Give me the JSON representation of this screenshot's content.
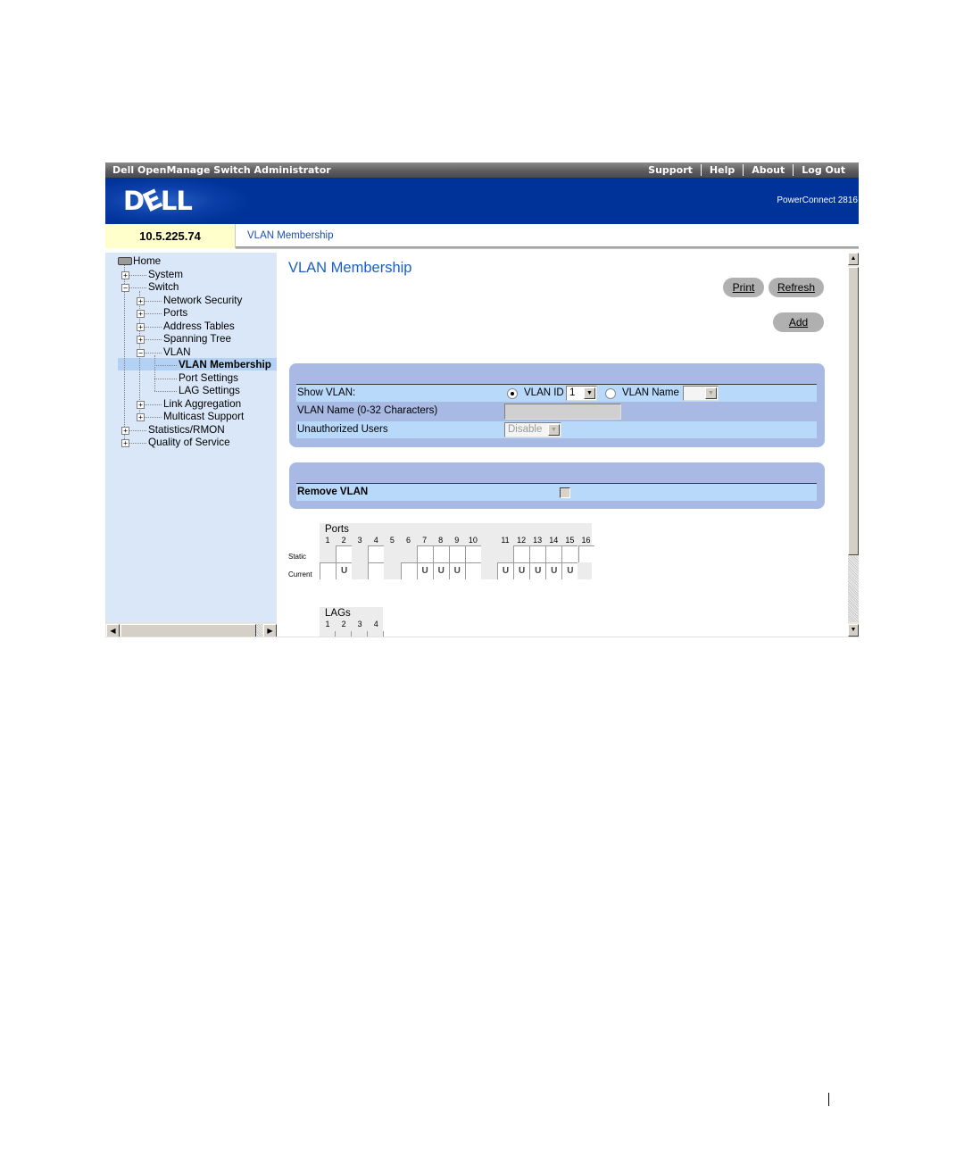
{
  "window": {
    "app_title": "Dell OpenManage Switch Administrator",
    "top_links": [
      "Support",
      "Help",
      "About",
      "Log Out"
    ]
  },
  "banner": {
    "logo": "DELL",
    "model": "PowerConnect 2816"
  },
  "ip_bar": {
    "ip_address": "10.5.225.74",
    "breadcrumb": "VLAN Membership"
  },
  "sidebar": {
    "tree": [
      {
        "label": "Home",
        "level": 0,
        "expander": "none"
      },
      {
        "label": "System",
        "level": 1,
        "expander": "plus"
      },
      {
        "label": "Switch",
        "level": 1,
        "expander": "minus"
      },
      {
        "label": "Network Security",
        "level": 2,
        "expander": "plus"
      },
      {
        "label": "Ports",
        "level": 2,
        "expander": "plus"
      },
      {
        "label": "Address Tables",
        "level": 2,
        "expander": "plus"
      },
      {
        "label": "Spanning Tree",
        "level": 2,
        "expander": "plus"
      },
      {
        "label": "VLAN",
        "level": 2,
        "expander": "minus"
      },
      {
        "label": "VLAN Membership",
        "level": 3,
        "expander": "none",
        "selected": true
      },
      {
        "label": "Port Settings",
        "level": 3,
        "expander": "none"
      },
      {
        "label": "LAG Settings",
        "level": 3,
        "expander": "none"
      },
      {
        "label": "Link Aggregation",
        "level": 2,
        "expander": "plus"
      },
      {
        "label": "Multicast Support",
        "level": 2,
        "expander": "plus"
      },
      {
        "label": "Statistics/RMON",
        "level": 1,
        "expander": "plus"
      },
      {
        "label": "Quality of Service",
        "level": 1,
        "expander": "plus"
      }
    ]
  },
  "main": {
    "title": "VLAN Membership",
    "buttons": {
      "print": "Print",
      "refresh": "Refresh",
      "add": "Add"
    },
    "vlan_form": {
      "show_vlan_label": "Show VLAN:",
      "vlan_id_radio_label": "VLAN ID",
      "vlan_id_selected": true,
      "vlan_id_value": "1",
      "vlan_name_radio_label": "VLAN Name",
      "vlan_name_selected": false,
      "vlan_name_value": "",
      "vlan_name_field_label": "VLAN Name (0-32 Characters)",
      "vlan_name_field_value": "",
      "unauthorized_users_label": "Unauthorized Users",
      "unauthorized_users_value": "Disable"
    },
    "remove_panel": {
      "remove_vlan_label": "Remove VLAN",
      "remove_vlan_checked": false
    },
    "ports": {
      "title": "Ports",
      "row_labels": [
        "Static",
        "Current"
      ],
      "port_numbers": [
        "1",
        "2",
        "3",
        "4",
        "5",
        "6",
        "7",
        "8",
        "9",
        "10",
        "11",
        "12",
        "13",
        "14",
        "15",
        "16"
      ],
      "static": [
        "",
        "",
        "",
        "",
        "",
        "",
        "",
        "",
        "",
        "",
        "",
        "",
        "",
        "",
        "",
        ""
      ],
      "current": [
        "",
        "U",
        "",
        "",
        "",
        "",
        "U",
        "U",
        "U",
        "",
        "U",
        "U",
        "U",
        "U",
        "U",
        ""
      ]
    },
    "lags": {
      "title": "LAGs",
      "lag_numbers": [
        "1",
        "2",
        "3",
        "4"
      ]
    }
  }
}
